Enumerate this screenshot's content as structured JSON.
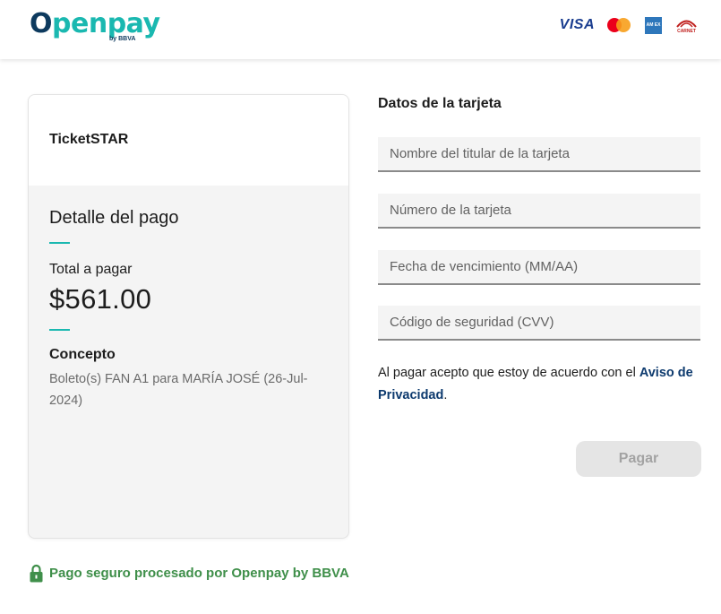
{
  "header": {
    "logo": {
      "main_o": "O",
      "main_rest": "penpay",
      "sub": "by BBVA"
    },
    "card_brands": {
      "visa": "VISA",
      "amex": "AMERICAN EXPRESS",
      "carnet": "CARNET"
    }
  },
  "summary": {
    "merchant": "TicketSTAR",
    "detail_title": "Detalle del pago",
    "total_label": "Total a pagar",
    "total_value": "$561.00",
    "concept_label": "Concepto",
    "concept_text": "Boleto(s) FAN A1 para MARÍA JOSÉ (26-Jul-2024)"
  },
  "form": {
    "title": "Datos de la tarjeta",
    "fields": [
      {
        "placeholder": "Nombre del titular de la tarjeta",
        "value": ""
      },
      {
        "placeholder": "Número de la tarjeta",
        "value": ""
      },
      {
        "placeholder": "Fecha de vencimiento (MM/AA)",
        "value": ""
      },
      {
        "placeholder": "Código de seguridad (CVV)",
        "value": ""
      }
    ],
    "consent_text": "Al pagar acepto que estoy de acuerdo con el ",
    "consent_link": "Aviso de Privacidad",
    "consent_end": ".",
    "pay_button": "Pagar"
  },
  "footer": {
    "secure_text": "Pago seguro procesado por Openpay by BBVA"
  },
  "colors": {
    "accent": "#1ab8b0",
    "brand_dark": "#0d3a5e",
    "link": "#0d3a6e",
    "secure_green": "#3f8f4a",
    "button_disabled": "#e5e5e5"
  }
}
